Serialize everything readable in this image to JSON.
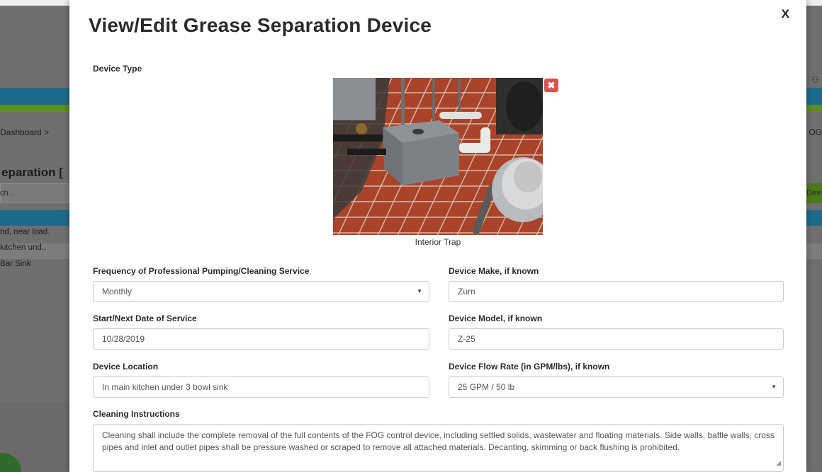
{
  "background": {
    "breadcrumb": "Dashboard >",
    "breadcrumb_right": "OG",
    "page_title": "eparation [",
    "search_placeholder": "ch...",
    "green_button_label": "Devi",
    "rows": [
      "nd, near load.",
      " kitchen und..",
      "Bar Sink"
    ]
  },
  "modal": {
    "title": "View/Edit Grease Separation Device",
    "close_label": "X",
    "device_type_label": "Device Type",
    "photo_remove_icon": "close-icon",
    "photo_caption": "Interior Trap",
    "fields": {
      "frequency": {
        "label": "Frequency of Professional Pumping/Cleaning Service",
        "value": "Monthly"
      },
      "make": {
        "label": "Device Make, if known",
        "value": "Zurn"
      },
      "start_date": {
        "label": "Start/Next Date of Service",
        "value": "10/28/2019"
      },
      "model": {
        "label": "Device Model, if known",
        "value": "Z-25"
      },
      "location": {
        "label": "Device Location",
        "value": "In main kitchen under 3 bowl sink"
      },
      "flow_rate": {
        "label": "Device Flow Rate (in GPM/lbs), if known",
        "value": "25 GPM / 50 lb"
      },
      "cleaning": {
        "label": "Cleaning Instructions",
        "value": "Cleaning shall include the complete removal of the full contents of the FOG control device, including settled solids, wastewater and floating materials. Side walls, baffle walls, cross pipes and inlet and outlet pipes shall be pressure washed or scraped to remove all attached materials. Decanting, skimming or back flushing is prohibited."
      }
    }
  },
  "colors": {
    "remove_button": "#d9534f",
    "nav_blue": "#1d6b8c",
    "nav_green": "#5f8a24"
  }
}
